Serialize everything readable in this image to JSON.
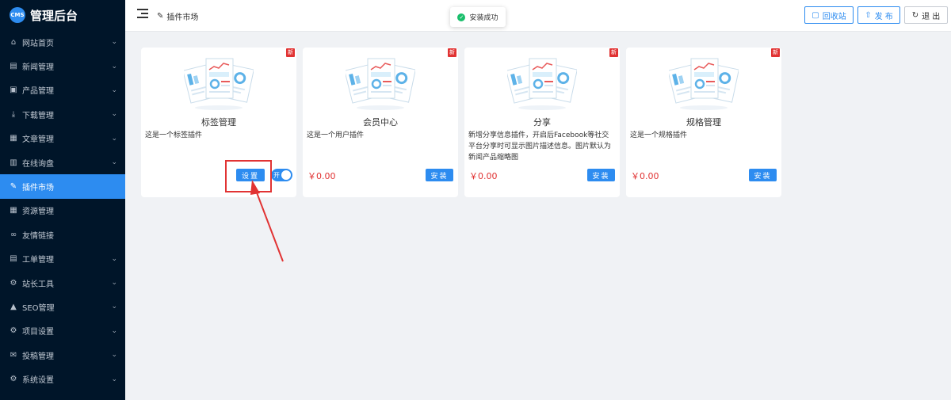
{
  "app": {
    "logo_badge": "CMS",
    "title": "管理后台"
  },
  "sidebar": {
    "items": [
      {
        "label": "网站首页",
        "icon": "home-icon",
        "glyph": "⌂",
        "arrow": true,
        "active": false
      },
      {
        "label": "新闻管理",
        "icon": "news-icon",
        "glyph": "▤",
        "arrow": true,
        "active": false
      },
      {
        "label": "产品管理",
        "icon": "product-icon",
        "glyph": "▣",
        "arrow": true,
        "active": false
      },
      {
        "label": "下载管理",
        "icon": "download-icon",
        "glyph": "⤓",
        "arrow": true,
        "active": false
      },
      {
        "label": "文章管理",
        "icon": "article-icon",
        "glyph": "▦",
        "arrow": true,
        "active": false
      },
      {
        "label": "在线询盘",
        "icon": "inquiry-icon",
        "glyph": "▥",
        "arrow": true,
        "active": false
      },
      {
        "label": "插件市场",
        "icon": "pin-icon",
        "glyph": "✎",
        "arrow": false,
        "active": true
      },
      {
        "label": "资源管理",
        "icon": "grid-icon",
        "glyph": "▦",
        "arrow": false,
        "active": false
      },
      {
        "label": "友情链接",
        "icon": "link-icon",
        "glyph": "∞",
        "arrow": false,
        "active": false
      },
      {
        "label": "工单管理",
        "icon": "ticket-icon",
        "glyph": "▤",
        "arrow": true,
        "active": false
      },
      {
        "label": "站长工具",
        "icon": "tools-icon",
        "glyph": "⚙",
        "arrow": true,
        "active": false
      },
      {
        "label": "SEO管理",
        "icon": "warning-icon",
        "glyph": "▲",
        "arrow": true,
        "active": false
      },
      {
        "label": "项目设置",
        "icon": "gear-icon",
        "glyph": "⚙",
        "arrow": true,
        "active": false
      },
      {
        "label": "投稿管理",
        "icon": "mail-icon",
        "glyph": "✉",
        "arrow": true,
        "active": false
      },
      {
        "label": "系统设置",
        "icon": "settings-icon",
        "glyph": "⚙",
        "arrow": true,
        "active": false
      }
    ]
  },
  "header": {
    "breadcrumb": "插件市场",
    "recycle_label": "回收站",
    "publish_label": "发 布",
    "logout_label": "退 出"
  },
  "toast": {
    "message": "安装成功"
  },
  "cards": [
    {
      "title": "标签管理",
      "desc": "这是一个标签插件",
      "badge": "新",
      "settings_label": "设置",
      "toggle_label": "开"
    },
    {
      "title": "会员中心",
      "desc": "这是一个用户插件",
      "badge": "新",
      "price": "￥0.00",
      "install_label": "安装"
    },
    {
      "title": "分享",
      "desc": "新增分享信息插件，开启后Facebook等社交平台分享时可显示图片描述信息。图片默认为新闻产品缩略图",
      "badge": "新",
      "price": "￥0.00",
      "install_label": "安装"
    },
    {
      "title": "规格管理",
      "desc": "这是一个规格插件",
      "badge": "新",
      "price": "￥0.00",
      "install_label": "安装"
    }
  ],
  "colors": {
    "primary": "#2d8cf0",
    "sidebar_bg": "#001529",
    "badge_red": "#e13333",
    "success": "#19be6b"
  }
}
